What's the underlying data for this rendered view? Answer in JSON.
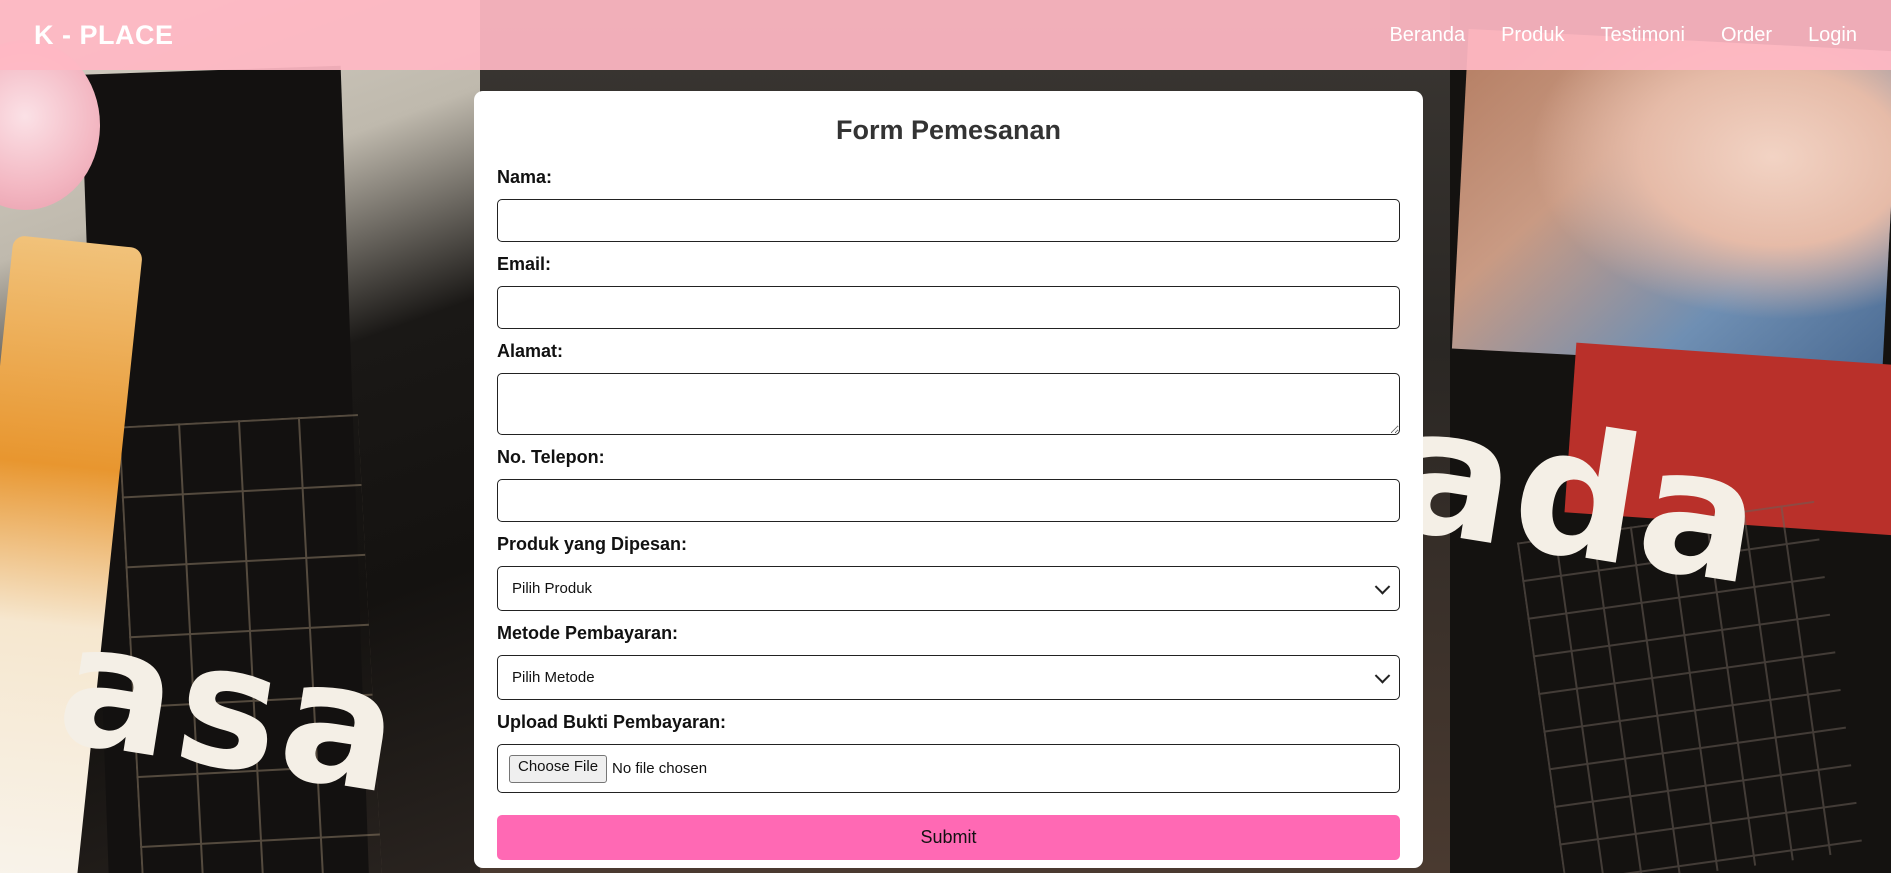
{
  "navbar": {
    "brand": "K - PLACE",
    "links": [
      "Beranda",
      "Produk",
      "Testimoni",
      "Order",
      "Login"
    ]
  },
  "background": {
    "word_left": "asa",
    "word_right": "ada"
  },
  "form": {
    "title": "Form Pemesanan",
    "nama_label": "Nama:",
    "nama_value": "",
    "email_label": "Email:",
    "email_value": "",
    "alamat_label": "Alamat:",
    "alamat_value": "",
    "telepon_label": "No. Telepon:",
    "telepon_value": "",
    "produk_label": "Produk yang Dipesan:",
    "produk_selected": "Pilih Produk",
    "metode_label": "Metode Pembayaran:",
    "metode_selected": "Pilih Metode",
    "upload_label": "Upload Bukti Pembayaran:",
    "file_button": "Choose File",
    "file_status": "No file chosen",
    "submit_label": "Submit"
  },
  "colors": {
    "navbar": "#ffb8c4",
    "submit": "#ff69b4",
    "card": "#ffffff"
  }
}
